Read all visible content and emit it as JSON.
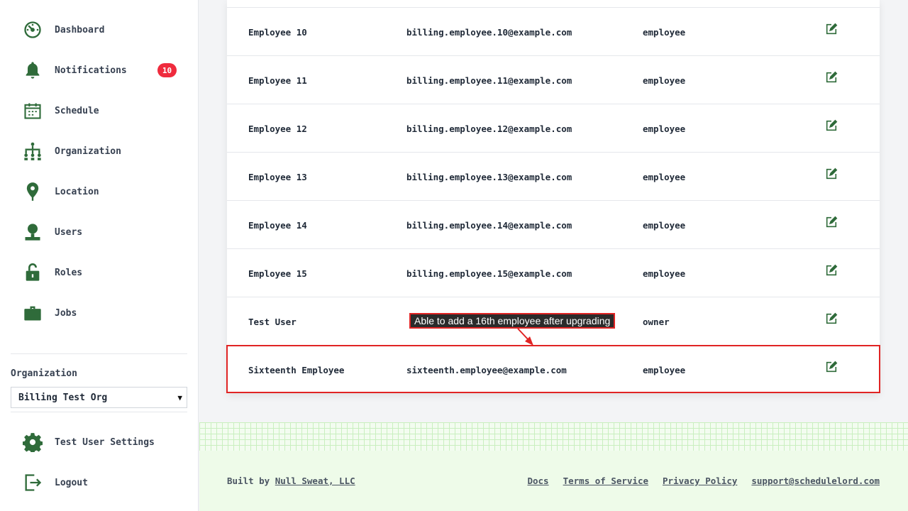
{
  "sidebar": {
    "items": [
      {
        "label": "Dashboard",
        "icon": "dashboard-icon"
      },
      {
        "label": "Notifications",
        "icon": "bell-icon",
        "badge": "10"
      },
      {
        "label": "Schedule",
        "icon": "calendar-icon"
      },
      {
        "label": "Organization",
        "icon": "org-chart-icon"
      },
      {
        "label": "Location",
        "icon": "map-pin-icon"
      },
      {
        "label": "Users",
        "icon": "user-icon"
      },
      {
        "label": "Roles",
        "icon": "unlock-icon"
      },
      {
        "label": "Jobs",
        "icon": "briefcase-icon"
      }
    ],
    "organization_label": "Organization",
    "organization_selected": "Billing Test Org",
    "settings_label": "Test User Settings",
    "logout_label": "Logout"
  },
  "table": {
    "rows": [
      {
        "name": "Employee 10",
        "email": "billing.employee.10@example.com",
        "role": "employee"
      },
      {
        "name": "Employee 11",
        "email": "billing.employee.11@example.com",
        "role": "employee"
      },
      {
        "name": "Employee 12",
        "email": "billing.employee.12@example.com",
        "role": "employee"
      },
      {
        "name": "Employee 13",
        "email": "billing.employee.13@example.com",
        "role": "employee"
      },
      {
        "name": "Employee 14",
        "email": "billing.employee.14@example.com",
        "role": "employee"
      },
      {
        "name": "Employee 15",
        "email": "billing.employee.15@example.com",
        "role": "employee"
      },
      {
        "name": "Test User",
        "email": "",
        "role": "owner"
      },
      {
        "name": "Sixteenth Employee",
        "email": "sixteenth.employee@example.com",
        "role": "employee"
      }
    ]
  },
  "annotation": {
    "text": "Able to add a 16th employee after upgrading"
  },
  "footer": {
    "built_by_prefix": "Built by",
    "built_by_link": "Null Sweat, LLC",
    "links": [
      "Docs",
      "Terms of Service",
      "Privacy Policy",
      "support@schedulelord.com"
    ]
  },
  "colors": {
    "accent_green": "#2f6b3a",
    "badge_red": "#ef2b3d",
    "highlight_red": "#e02424"
  }
}
